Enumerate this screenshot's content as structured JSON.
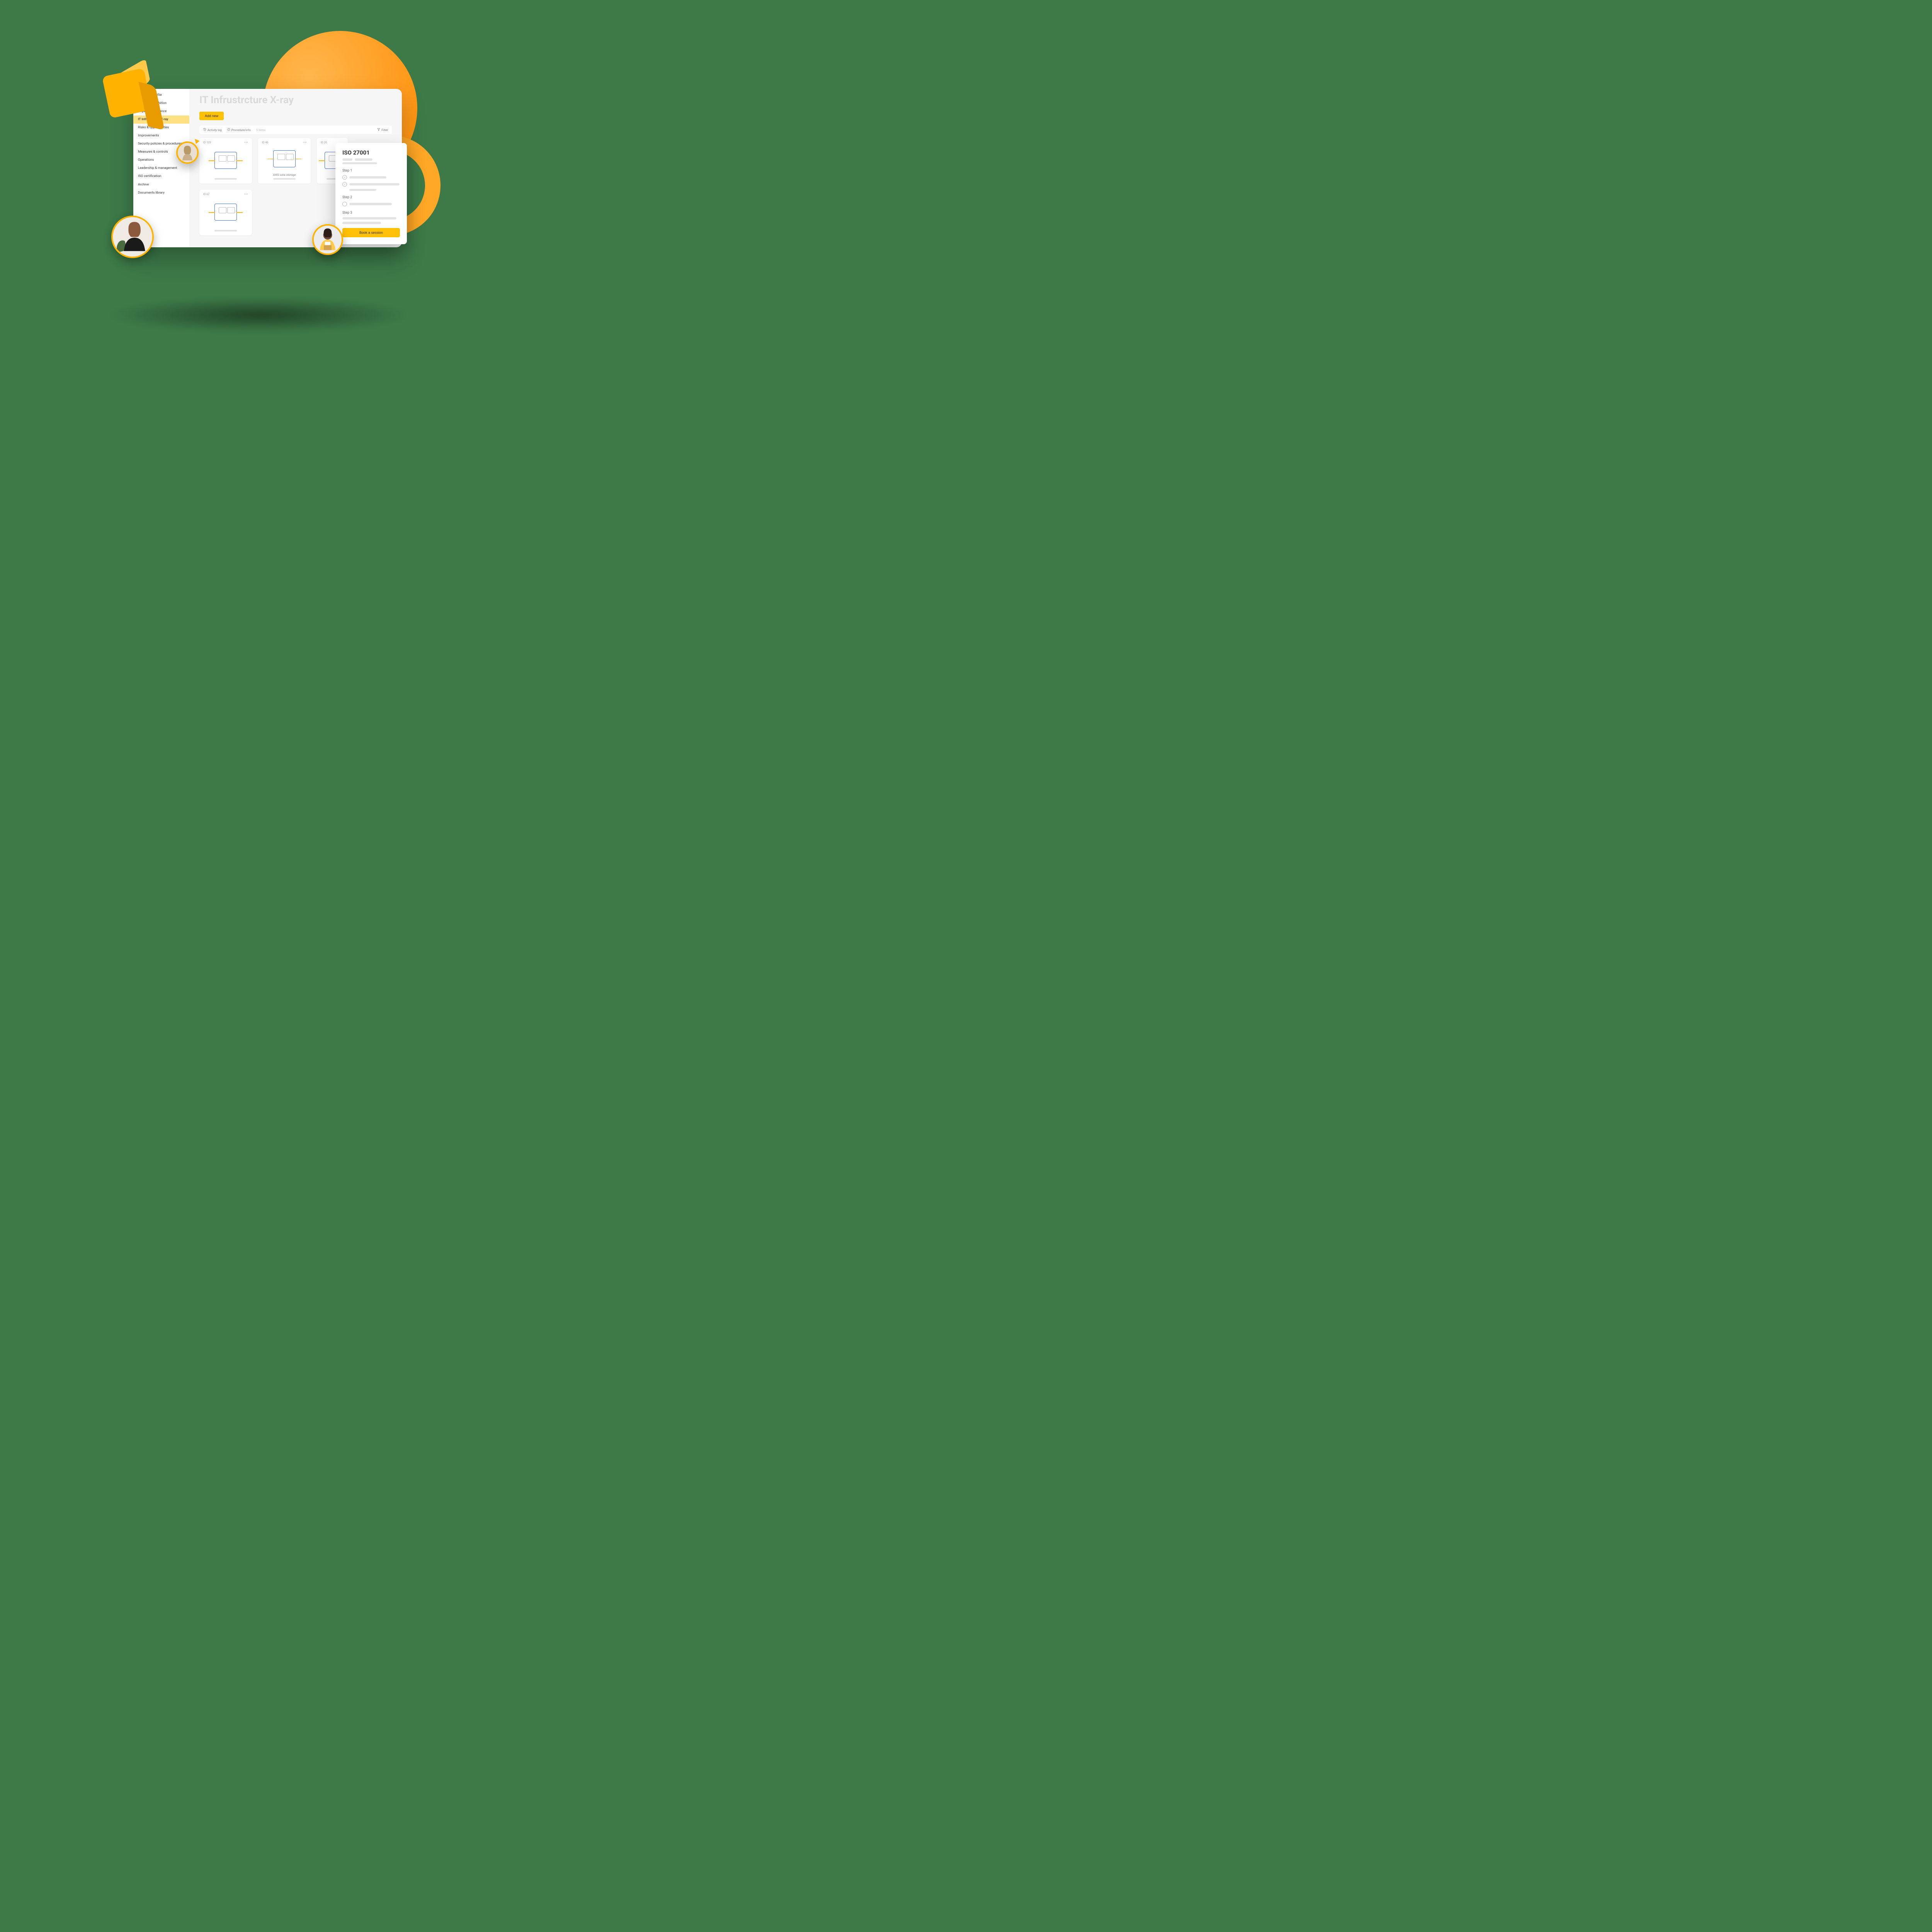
{
  "sidebar": {
    "items": [
      {
        "label": "Company profile"
      },
      {
        "label": "Strategy & ambition"
      },
      {
        "label": "Legal & compliance"
      },
      {
        "label": "IT Infrustrcture X-ray",
        "active": true
      },
      {
        "label": "Risks & opportunities"
      },
      {
        "label": "Improvements"
      },
      {
        "label": "Security policies & procedures"
      },
      {
        "label": "Measures & controls"
      },
      {
        "label": "Operations"
      },
      {
        "label": "Leadership & management"
      },
      {
        "label": "ISO certification"
      },
      {
        "label": "Archive"
      },
      {
        "label": "Documents library"
      }
    ]
  },
  "main": {
    "title": "IT Infrustrcture X-ray",
    "add_new": "Add new",
    "toolbar": {
      "activity_log": "Activity log",
      "procedure_info": "Procedure/info",
      "count": "5 items",
      "filter": "Filter"
    },
    "cards": [
      {
        "id": "ID 129",
        "label": ""
      },
      {
        "id": "ID 46",
        "label": "AWS sata storage"
      },
      {
        "id": "ID 35",
        "label": ""
      },
      {
        "id": "ID 67",
        "label": ""
      }
    ]
  },
  "popup": {
    "title": "ISO 27001",
    "steps": [
      {
        "label": "Step 1"
      },
      {
        "label": "Step 2"
      },
      {
        "label": "Step 3"
      }
    ],
    "book": "Book a session"
  },
  "colors": {
    "accent": "#FFC107",
    "accent_strong": "#FFB300",
    "background": "#3D7A48"
  }
}
